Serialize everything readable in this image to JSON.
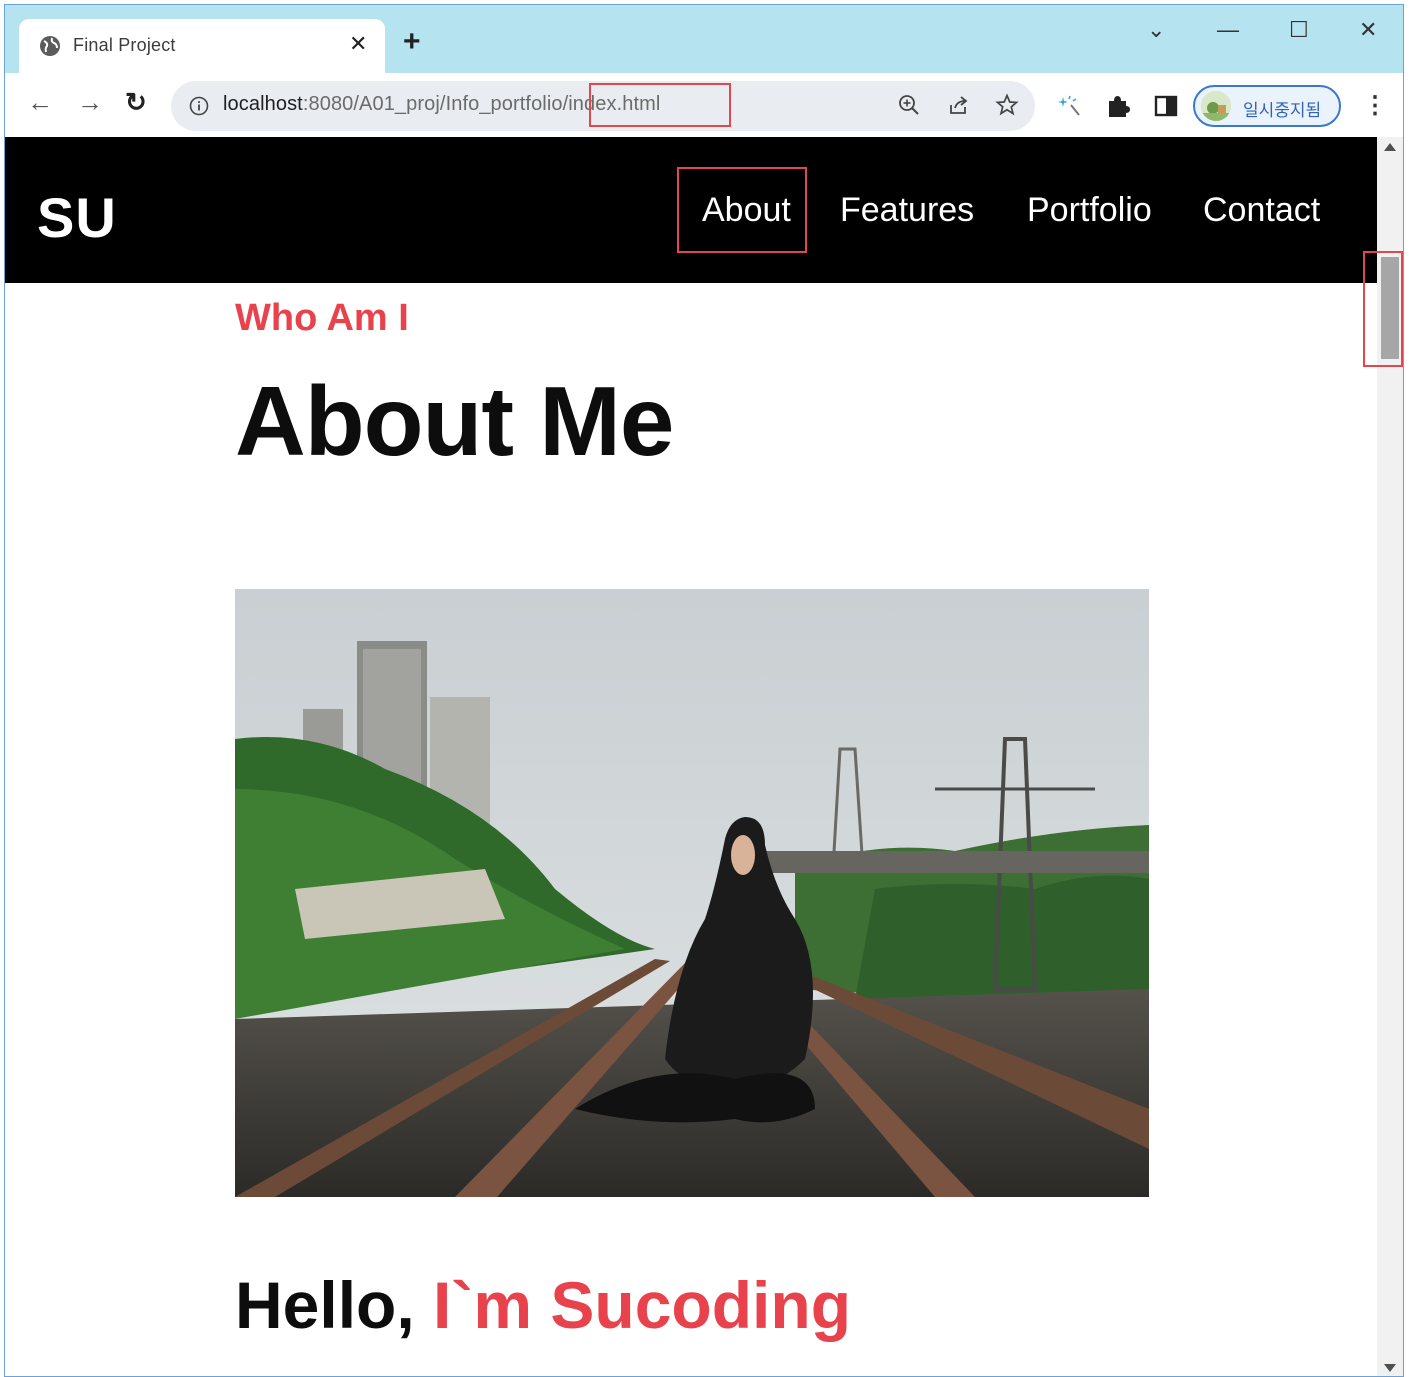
{
  "browser": {
    "tab_title": "Final Project",
    "tab_close": "✕",
    "new_tab": "+",
    "url_host": "localhost",
    "url_path": ":8080/A01_proj/Info_portfolio/index.html",
    "profile_label": "일시중지됨",
    "window_controls": {
      "dropdown": "⌄",
      "minimize": "—",
      "maximize": "☐",
      "close": "✕"
    },
    "nav_back": "←",
    "nav_forward": "→",
    "nav_reload": "↻",
    "menu": "⋮"
  },
  "site": {
    "logo": "SU",
    "nav": [
      "About",
      "Features",
      "Portfolio",
      "Contact"
    ]
  },
  "about": {
    "kicker": "Who Am I",
    "title": "About Me",
    "hello_prefix": "Hello, ",
    "hello_name": "I`m Sucoding"
  },
  "colors": {
    "accent": "#e8434c",
    "header_bg": "#000000",
    "tabbar_bg": "#b5e3f0",
    "annotation_box": "#e2464e"
  }
}
